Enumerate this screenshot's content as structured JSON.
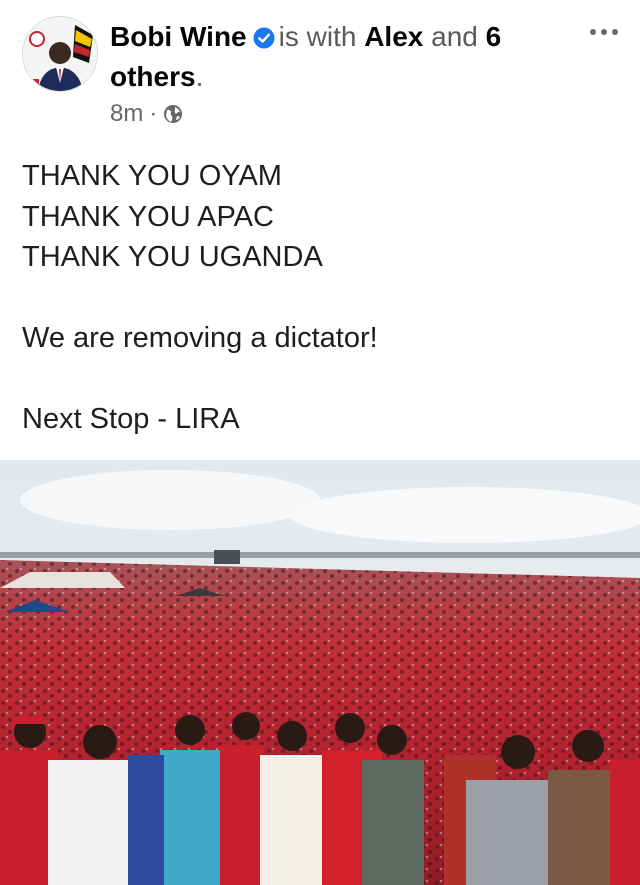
{
  "post": {
    "author": "Bobi Wine",
    "with_text": "is with",
    "tagged_first": "Alex",
    "and_text": "and",
    "others_count": "6",
    "others_word": "others",
    "period": ".",
    "time": "8m",
    "separator": "·",
    "audience_icon": "globe-icon",
    "lines": [
      "THANK YOU OYAM",
      "THANK YOU APAC",
      "THANK YOU UGANDA",
      "",
      "We are removing a dictator!",
      "",
      "Next Stop - LIRA"
    ]
  },
  "colors": {
    "verified": "#1877f2",
    "crowd_red": "#c4262f",
    "sky": "#e9eef2"
  }
}
